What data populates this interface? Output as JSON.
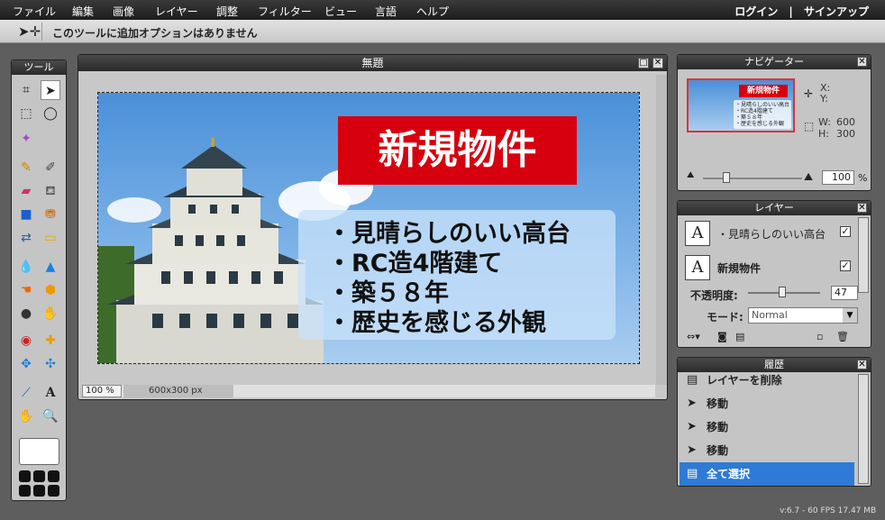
{
  "menu": {
    "items": [
      "ファイル",
      "編集",
      "画像",
      "レイヤー",
      "調整",
      "フィルター",
      "ビュー",
      "言語",
      "ヘルプ"
    ],
    "login": "ログイン",
    "separator": "|",
    "signup": "サインアップ"
  },
  "options": {
    "message": "このツールに追加オプションはありません"
  },
  "tools": {
    "title": "ツール"
  },
  "document": {
    "title": "無題",
    "zoom": "100 %",
    "size": "600x300 px",
    "image": {
      "headline": "新規物件",
      "bullets": [
        "・見晴らしのいい高台",
        "・RC造4階建て",
        "・築５８年",
        "・歴史を感じる外観"
      ]
    }
  },
  "navigator": {
    "title": "ナビゲーター",
    "x_label": "X:",
    "y_label": "Y:",
    "w_label": "W:",
    "w_value": "600",
    "h_label": "H:",
    "h_value": "300",
    "zoom_value": "100",
    "zoom_unit": "%"
  },
  "layers": {
    "title": "レイヤー",
    "items": [
      {
        "name": "・見晴らしのいい高台",
        "visible": true
      },
      {
        "name": "新規物件",
        "visible": true
      }
    ],
    "opacity_label": "不透明度:",
    "opacity_value": "47",
    "opacity_level": 0.47,
    "mode_label": "モード:",
    "mode_value": "Normal"
  },
  "history": {
    "title": "履歴",
    "items": [
      {
        "label": "レイヤーを削除",
        "selected": false
      },
      {
        "label": "移動",
        "selected": false
      },
      {
        "label": "移動",
        "selected": false
      },
      {
        "label": "移動",
        "selected": false
      },
      {
        "label": "全て選択",
        "selected": true
      }
    ]
  },
  "status": {
    "version": "v:6.7 - 60 FPS 17.47 MB"
  },
  "colors": {
    "accent": "#2e7ad6",
    "headline_bg": "#d7000f"
  }
}
